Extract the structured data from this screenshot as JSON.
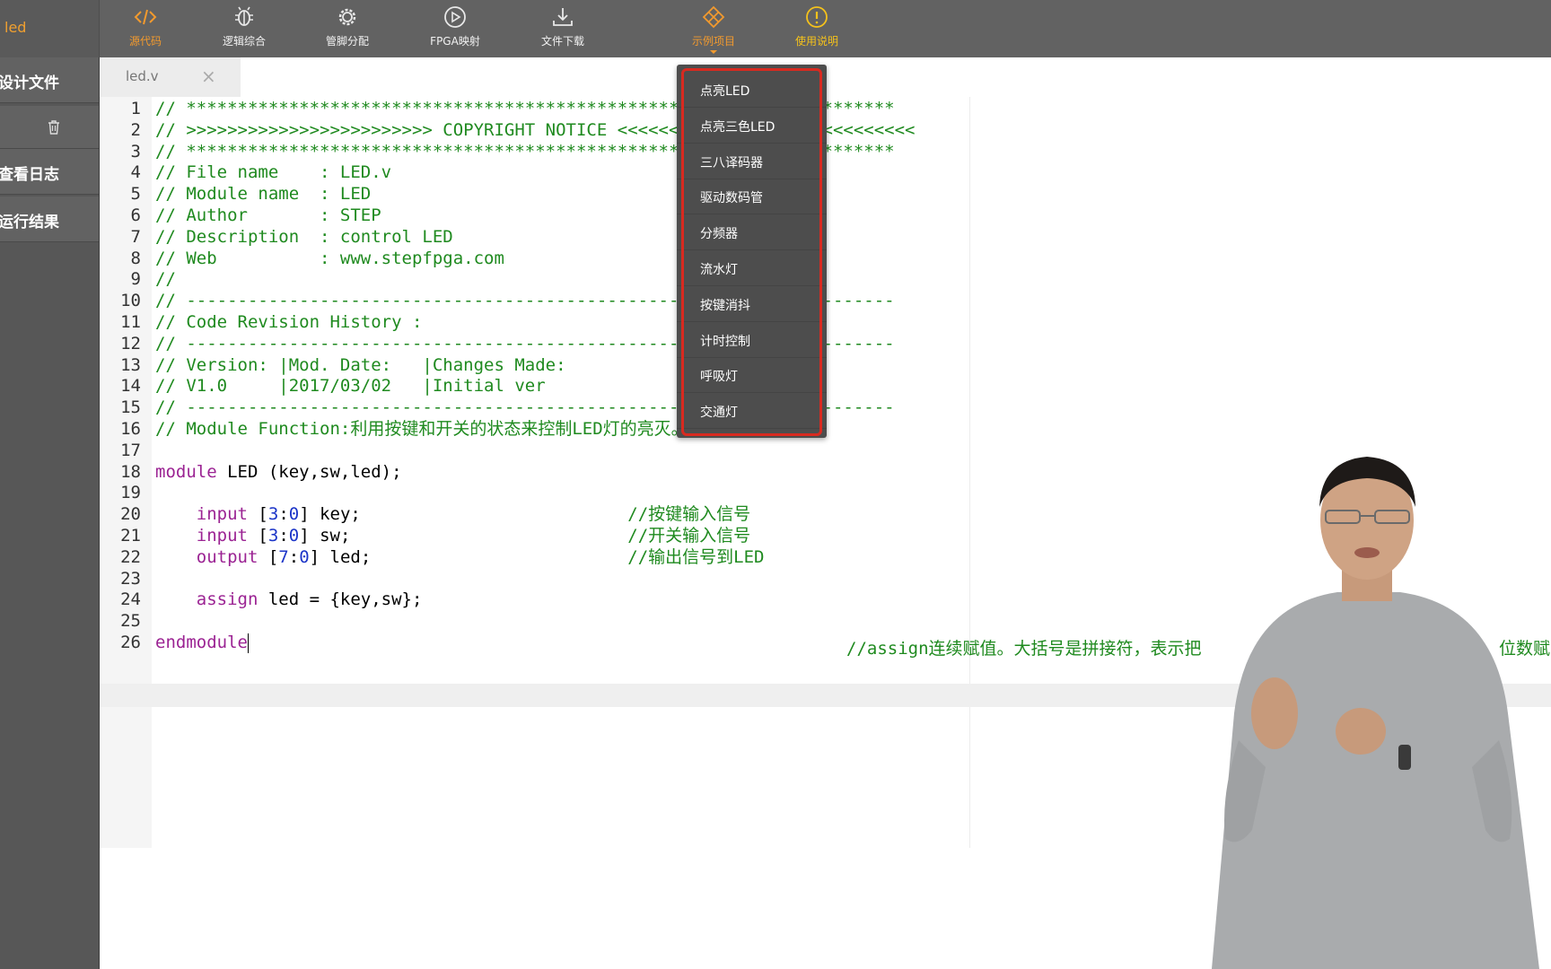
{
  "project": {
    "name": "led"
  },
  "toolbar": {
    "items": [
      {
        "label": "源代码",
        "icon": "code-icon"
      },
      {
        "label": "逻辑综合",
        "icon": "bug-icon"
      },
      {
        "label": "管脚分配",
        "icon": "gear-icon"
      },
      {
        "label": "FPGA映射",
        "icon": "play-icon"
      },
      {
        "label": "文件下载",
        "icon": "download-icon"
      },
      {
        "label": "示例项目",
        "icon": "diamond-icon"
      },
      {
        "label": "使用说明",
        "icon": "alert-icon"
      }
    ]
  },
  "sidebar": {
    "design_files": "设计文件",
    "view_log": "查看日志",
    "run_results": "运行结果"
  },
  "editor": {
    "tab_name": "led.v",
    "lines": [
      "// *********************************************************************",
      "// >>>>>>>>>>>>>>>>>>>>>>>> COPYRIGHT NOTICE <<<<<<<<<<<<<<<<<<<<<<<<<<<<<",
      "// *********************************************************************",
      "// File name    : LED.v",
      "// Module name  : LED",
      "// Author       : STEP",
      "// Description  : control LED",
      "// Web          : www.stepfpga.com",
      "//",
      "// ---------------------------------------------------------------------",
      "// Code Revision History :",
      "// ---------------------------------------------------------------------",
      "// Version: |Mod. Date:   |Changes Made:",
      "// V1.0     |2017/03/02   |Initial ver",
      "// ---------------------------------------------------------------------",
      "// Module Function:利用按键和开关的状态来控制LED灯的亮灭。",
      "",
      "module LED (key,sw,led);",
      "",
      "    input [3:0] key;                          //按键输入信号",
      "    input [3:0] sw;                           //开关输入信号",
      "    output [7:0] led;                         //输出信号到LED",
      "",
      "    assign led = {key,sw};",
      "",
      "endmodule"
    ],
    "line24_comment": "//assign连续赋值。大括号是拼接符，表示把",
    "line24_comment_tail": "位数赋"
  },
  "dropdown": {
    "items": [
      "点亮LED",
      "点亮三色LED",
      "三八译码器",
      "驱动数码管",
      "分频器",
      "流水灯",
      "按键消抖",
      "计时控制",
      "呼吸灯",
      "交通灯"
    ]
  },
  "colors": {
    "toolbar_bg": "#626262",
    "accent_orange": "#f29a2e",
    "accent_yellow": "#f5c21b",
    "comment_green": "#1f8a1f",
    "keyword_purple": "#9b2393",
    "number_blue": "#1c35c8",
    "highlight_red": "#d82a20"
  }
}
